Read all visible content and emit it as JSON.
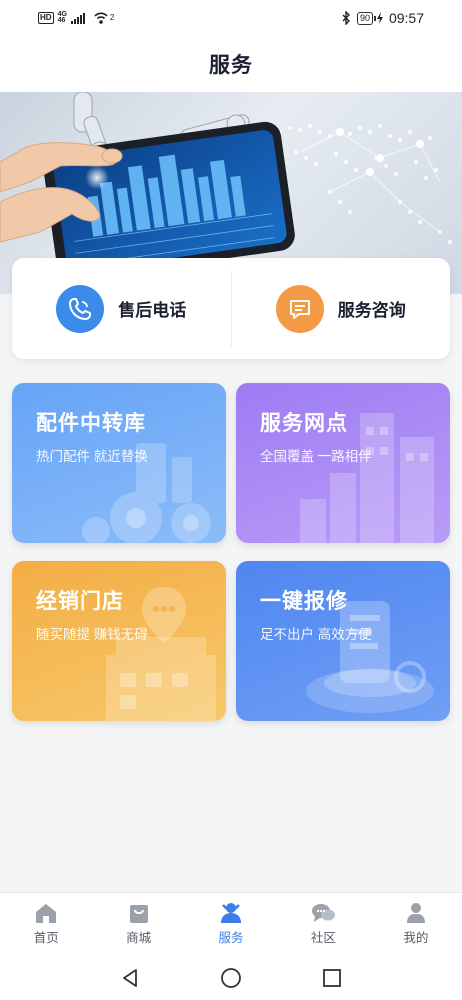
{
  "status_bar": {
    "hd": "HD",
    "network_top": "4G",
    "network_bottom": "46",
    "wifi_sup": "2",
    "battery": "90",
    "time": "09:57"
  },
  "header": {
    "title": "服务"
  },
  "contact": {
    "after_sales": {
      "label": "售后电话",
      "icon": "phone-icon",
      "color": "#3b8beb"
    },
    "consult": {
      "label": "服务咨询",
      "icon": "message-icon",
      "color": "#f49a45"
    }
  },
  "tiles": [
    {
      "title": "配件中转库",
      "subtitle": "热门配件 就近替换",
      "color": "#66a4f7"
    },
    {
      "title": "服务网点",
      "subtitle": "全国覆盖 一路相伴",
      "color": "#9d7cf3"
    },
    {
      "title": "经销门店",
      "subtitle": "随买随提 赚钱无碍",
      "color": "#f3ad45"
    },
    {
      "title": "一键报修",
      "subtitle": "足不出户 高效方便",
      "color": "#4f86f0"
    }
  ],
  "nav": {
    "active_color": "#3b7de9",
    "items": [
      {
        "label": "首页",
        "icon": "home-icon"
      },
      {
        "label": "商城",
        "icon": "shop-icon"
      },
      {
        "label": "服务",
        "icon": "service-icon"
      },
      {
        "label": "社区",
        "icon": "community-icon"
      },
      {
        "label": "我的",
        "icon": "profile-icon"
      }
    ]
  }
}
